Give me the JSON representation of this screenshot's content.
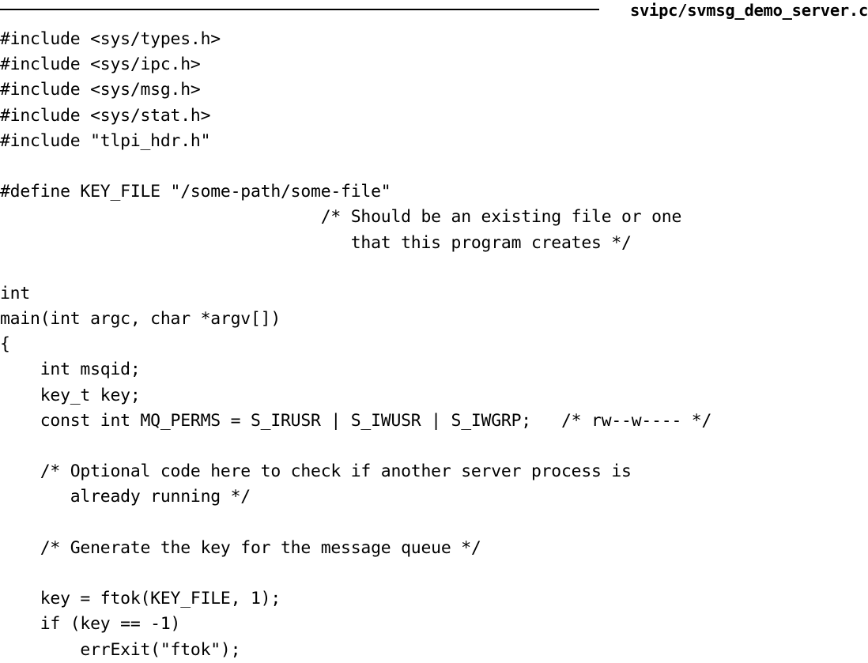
{
  "header": {
    "filename": "svipc/svmsg_demo_server.c"
  },
  "code": {
    "lines": [
      "#include <sys/types.h>",
      "#include <sys/ipc.h>",
      "#include <sys/msg.h>",
      "#include <sys/stat.h>",
      "#include \"tlpi_hdr.h\"",
      "",
      "#define KEY_FILE \"/some-path/some-file\"",
      "                                /* Should be an existing file or one",
      "                                   that this program creates */",
      "",
      "int",
      "main(int argc, char *argv[])",
      "{",
      "    int msqid;",
      "    key_t key;",
      "    const int MQ_PERMS = S_IRUSR | S_IWUSR | S_IWGRP;   /* rw--w---- */",
      "",
      "    /* Optional code here to check if another server process is",
      "       already running */",
      "",
      "    /* Generate the key for the message queue */",
      "",
      "    key = ftok(KEY_FILE, 1);",
      "    if (key == -1)",
      "        errExit(\"ftok\");"
    ]
  }
}
